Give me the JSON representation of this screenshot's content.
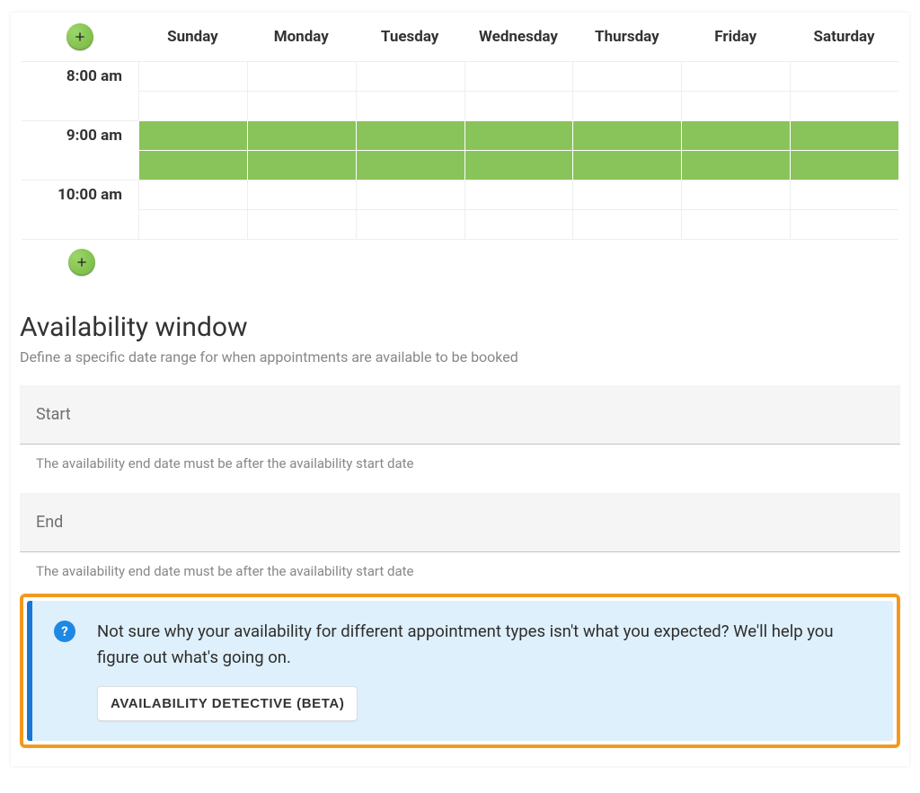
{
  "schedule": {
    "days": [
      "Sunday",
      "Monday",
      "Tuesday",
      "Wednesday",
      "Thursday",
      "Friday",
      "Saturday"
    ],
    "hours": [
      "8:00 am",
      "9:00 am",
      "10:00 am"
    ],
    "availability": [
      [
        false,
        false,
        false,
        false,
        false,
        false,
        false
      ],
      [
        false,
        false,
        false,
        false,
        false,
        false,
        false
      ],
      [
        true,
        true,
        true,
        true,
        true,
        true,
        true
      ],
      [
        true,
        true,
        true,
        true,
        true,
        true,
        true
      ],
      [
        false,
        false,
        false,
        false,
        false,
        false,
        false
      ],
      [
        false,
        false,
        false,
        false,
        false,
        false,
        false
      ]
    ]
  },
  "window": {
    "title": "Availability window",
    "subtitle": "Define a specific date range for when appointments are available to be booked",
    "start_label": "Start",
    "end_label": "End",
    "hint": "The availability end date must be after the availability start date"
  },
  "callout": {
    "text": "Not sure why your availability for different appointment types isn't what you expected? We'll help you figure out what's going on.",
    "button": "AVAILABILITY DETECTIVE (BETA)"
  }
}
